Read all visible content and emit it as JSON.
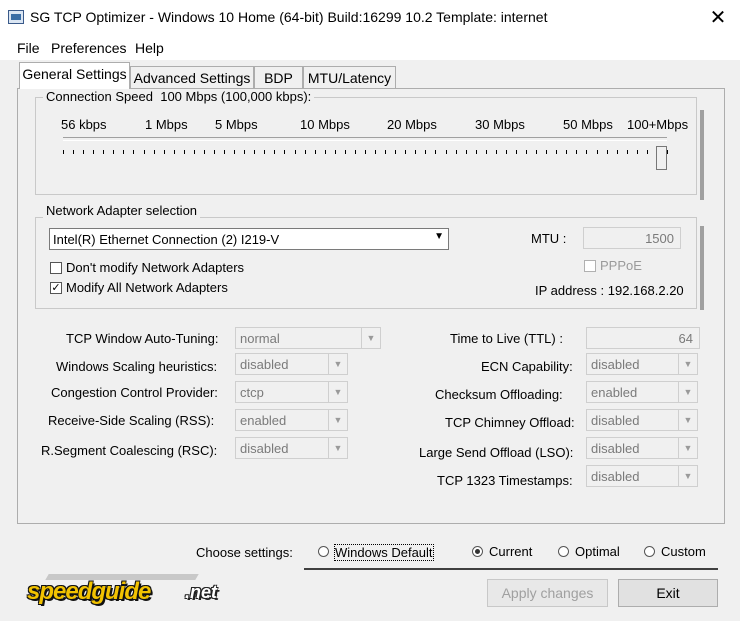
{
  "window": {
    "title": "SG TCP Optimizer - Windows 10 Home (64-bit) Build:16299 10.2  Template: internet",
    "close_glyph": "✕"
  },
  "menu": [
    "File",
    "Preferences",
    "Help"
  ],
  "tabs": [
    "General Settings",
    "Advanced Settings",
    "BDP",
    "MTU/Latency"
  ],
  "connection_speed": {
    "label": "Connection Speed",
    "value_text": "100 Mbps (100,000 kbps):",
    "ticks": [
      "56 kbps",
      "1 Mbps",
      "5 Mbps",
      "10 Mbps",
      "20 Mbps",
      "30 Mbps",
      "50 Mbps",
      "100+Mbps"
    ],
    "slider_position": 1.0
  },
  "adapter": {
    "label": "Network Adapter selection",
    "selected": "Intel(R) Ethernet Connection (2) I219-V",
    "dont_modify": "Don't modify Network Adapters",
    "modify_all": "Modify All Network Adapters",
    "modify_all_checked": true,
    "mtu_label": "MTU :",
    "mtu_value": "1500",
    "pppoe_label": "PPPoE",
    "ip_text": "IP address : 192.168.2.20"
  },
  "left_settings": [
    {
      "label": "TCP Window Auto-Tuning:",
      "value": "normal"
    },
    {
      "label": "Windows Scaling heuristics:",
      "value": "disabled"
    },
    {
      "label": "Congestion Control Provider:",
      "value": "ctcp"
    },
    {
      "label": "Receive-Side Scaling (RSS):",
      "value": "enabled"
    },
    {
      "label": "R.Segment Coalescing (RSC):",
      "value": "disabled"
    }
  ],
  "right_settings": [
    {
      "label": "Time to Live (TTL) :",
      "value": "64"
    },
    {
      "label": "ECN Capability:",
      "value": "disabled"
    },
    {
      "label": "Checksum Offloading:",
      "value": "enabled"
    },
    {
      "label": "TCP Chimney Offload:",
      "value": "disabled"
    },
    {
      "label": "Large Send Offload (LSO):",
      "value": "disabled"
    },
    {
      "label": "TCP 1323 Timestamps:",
      "value": "disabled"
    }
  ],
  "choose": {
    "label": "Choose settings:",
    "options": [
      "Windows Default",
      "Current",
      "Optimal",
      "Custom"
    ],
    "selected": "Current"
  },
  "logo": {
    "text": "speedguide",
    "suffix": ".net"
  },
  "buttons": {
    "apply": "Apply changes",
    "exit": "Exit"
  }
}
